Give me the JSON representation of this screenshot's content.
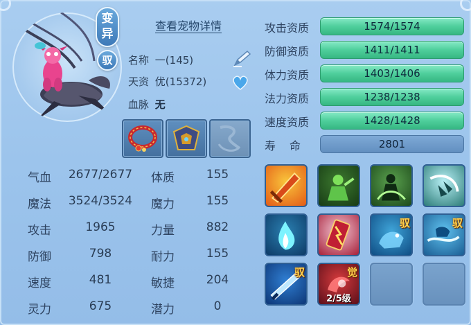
{
  "header": {
    "variant_badge": "变异",
    "ride_badge": "驭",
    "detail_link": "查看宠物详情"
  },
  "info": {
    "name_label": "名称",
    "name_value": "一(145)",
    "aptitude_label": "天资",
    "aptitude_value": "优(15372)",
    "bloodline_label": "血脉",
    "bloodline_value": "无"
  },
  "icons": {
    "edit": "pencil-icon",
    "favorite": "heart-icon"
  },
  "equipment": [
    {
      "name": "red-collar-equip",
      "empty": false
    },
    {
      "name": "armor-equip",
      "empty": false
    },
    {
      "name": "empty-equip-slot",
      "empty": true
    }
  ],
  "stats": [
    {
      "label": "气血",
      "value": "2677/2677"
    },
    {
      "label": "体质",
      "value": "155"
    },
    {
      "label": "魔法",
      "value": "3524/3524"
    },
    {
      "label": "魔力",
      "value": "155"
    },
    {
      "label": "攻击",
      "value": "1965"
    },
    {
      "label": "力量",
      "value": "882"
    },
    {
      "label": "防御",
      "value": "798"
    },
    {
      "label": "耐力",
      "value": "155"
    },
    {
      "label": "速度",
      "value": "481"
    },
    {
      "label": "敏捷",
      "value": "204"
    },
    {
      "label": "灵力",
      "value": "675"
    },
    {
      "label": "潜力",
      "value": "0"
    }
  ],
  "aptitudes": [
    {
      "label": "攻击资质",
      "value": "1574/1574",
      "fill": 1.0
    },
    {
      "label": "防御资质",
      "value": "1411/1411",
      "fill": 1.0
    },
    {
      "label": "体力资质",
      "value": "1403/1406",
      "fill": 0.998
    },
    {
      "label": "法力资质",
      "value": "1238/1238",
      "fill": 1.0
    },
    {
      "label": "速度资质",
      "value": "1428/1428",
      "fill": 1.0
    }
  ],
  "life": {
    "label": "寿命",
    "value": "2801"
  },
  "skills": [
    {
      "name": "sword-strike-skill",
      "tag": "",
      "level": ""
    },
    {
      "name": "poison-figure-skill",
      "tag": "",
      "level": ""
    },
    {
      "name": "warrior-shadow-skill",
      "tag": "",
      "level": ""
    },
    {
      "name": "wind-claw-skill",
      "tag": "",
      "level": ""
    },
    {
      "name": "blue-flame-skill",
      "tag": "",
      "level": ""
    },
    {
      "name": "lightning-scroll-skill",
      "tag": "",
      "level": ""
    },
    {
      "name": "ride-beast-skill",
      "tag": "驭",
      "level": ""
    },
    {
      "name": "ride-water-skill",
      "tag": "驭",
      "level": ""
    },
    {
      "name": "ride-blade-skill",
      "tag": "驭",
      "level": ""
    },
    {
      "name": "awaken-skill",
      "tag": "觉",
      "level": "2/5级"
    },
    {
      "name": "empty-skill-slot",
      "tag": "",
      "level": ""
    },
    {
      "name": "empty-skill-slot",
      "tag": "",
      "level": ""
    }
  ],
  "colors": {
    "background": "#9cc4ec",
    "aptitude_bar": "#4fcf9c",
    "life_bar": "#6f9bcb",
    "tag_gold": "#ffd34f"
  }
}
